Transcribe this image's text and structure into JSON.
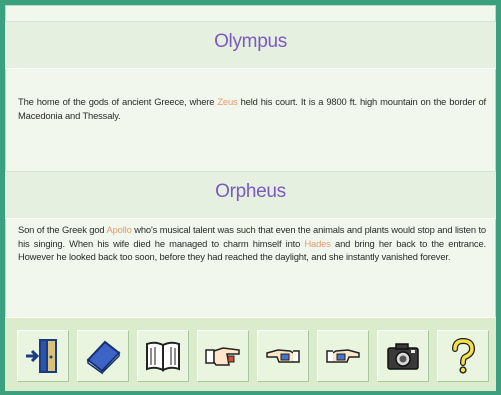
{
  "entries": [
    {
      "title": "Olympus",
      "text_before": "The home of the gods of ancient Greece, where ",
      "link": "Zeus",
      "text_after": " held his court.  It is a 9800 ft. high mountain on the border of Macedonia and Thessaly."
    },
    {
      "title": "Orpheus",
      "text_1": "Son of the Greek god ",
      "link_1": "Apollo",
      "text_2": " who's musical talent was such that even the animals and plants would stop and listen to his singing.  When his wife died he managed to charm himself into ",
      "link_2": "Hades",
      "text_3": " and bring her back to the entrance.  However he looked back too soon, before they had reached the daylight, and she instantly vanished forever."
    }
  ],
  "toolbar": {
    "buttons": [
      {
        "icon": "exit-door-icon"
      },
      {
        "icon": "closed-book-icon"
      },
      {
        "icon": "open-book-icon"
      },
      {
        "icon": "hand-pointing-right-icon"
      },
      {
        "icon": "hand-pointing-left-icon"
      },
      {
        "icon": "hand-pointing-forward-icon"
      },
      {
        "icon": "camera-icon"
      },
      {
        "icon": "help-question-icon"
      }
    ]
  },
  "colors": {
    "background": "#3aa07e",
    "panel": "#f2f7ee",
    "title": "#7a5bc0",
    "link": "#e39a6e",
    "toolbar": "#dbeccc"
  }
}
